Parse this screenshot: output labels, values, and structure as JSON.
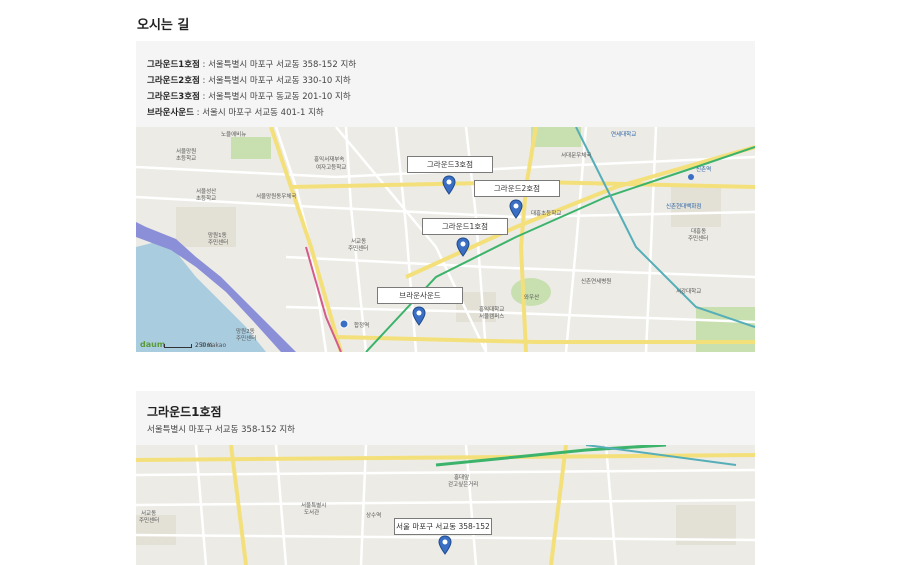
{
  "page": {
    "title": "오시는 길"
  },
  "addresses": [
    {
      "name": "그라운드1호점",
      "addr": " : 서울특별시 마포구 서교동 358-152 지하"
    },
    {
      "name": "그라운드2호점",
      "addr": " : 서울특별시 마포구 서교동 330-10 지하"
    },
    {
      "name": "그라운드3호점",
      "addr": " : 서울특별시 마포구 동교동 201-10 지하"
    },
    {
      "name": "브라운사운드",
      "addr": " : 서울시 마포구 서교동 401-1 지하"
    }
  ],
  "map1": {
    "markers": [
      {
        "label": "그라운드3호점"
      },
      {
        "label": "그라운드2호점"
      },
      {
        "label": "그라운드1호점"
      },
      {
        "label": "브라운사운드"
      }
    ],
    "places": [
      "노을에비뉴",
      "서울망원",
      "초등학교",
      "홍익서재부속",
      "여자고등학교",
      "연세대학교",
      "서대문우체국",
      "신촌역",
      "신촌현대백화점",
      "대흥초등학교",
      "서울망원동우체국",
      "망원1동",
      "주민센터",
      "서교동",
      "주민센터",
      "홍익대학교",
      "서울캠퍼스",
      "와우산",
      "신촌연세병원",
      "서강대학교",
      "합정역",
      "서울성산",
      "초등학교",
      "대흥동",
      "주민센터",
      "망원2동",
      "주민센터"
    ],
    "logo": "daum",
    "scale": "250m",
    "copyright": "© Kakao"
  },
  "branch": {
    "name": "그라운드1호점",
    "address": "서울특별시 마포구 서교동 358-152 지하"
  },
  "map2": {
    "marker_label": "서울 마포구 서교동 358-152",
    "places": [
      "서교동",
      "주민센터",
      "홍대앞",
      "걷고싶은거리",
      "상수역",
      "서울특별시",
      "도서관"
    ]
  },
  "colors": {
    "marker": "#3a6fc4",
    "road_major": "#f4e07a",
    "road_minor": "#ffffff",
    "river": "#8a8fd8",
    "park": "#c8dfb0"
  }
}
